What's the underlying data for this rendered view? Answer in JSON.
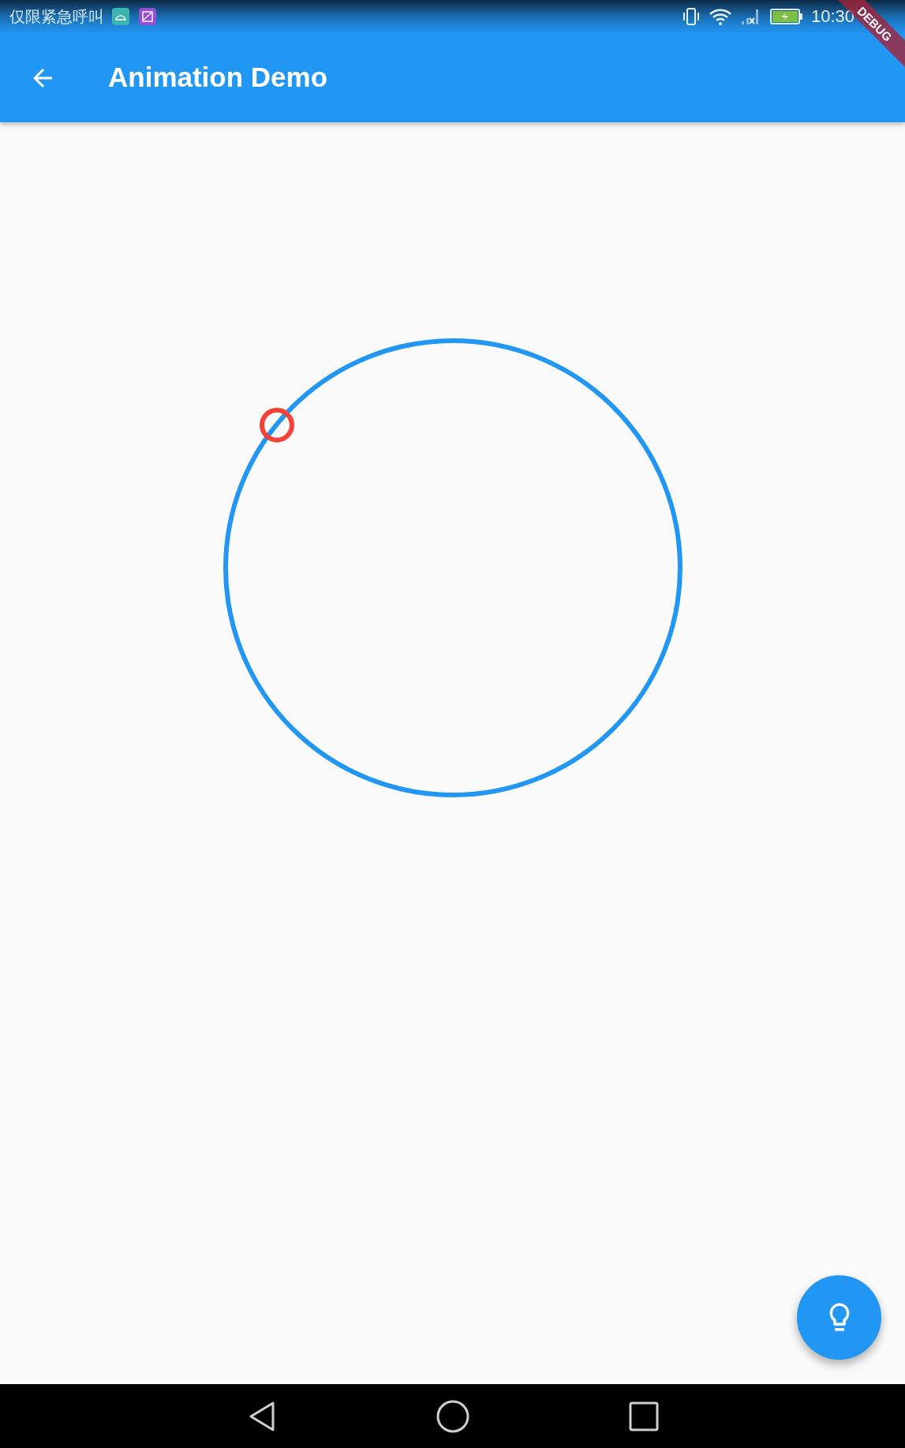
{
  "status_bar": {
    "carrier_text": "仅限紧急呼叫",
    "time": "10:30"
  },
  "app_bar": {
    "title": "Animation Demo"
  },
  "debug_banner": {
    "label": "DEBUG"
  }
}
